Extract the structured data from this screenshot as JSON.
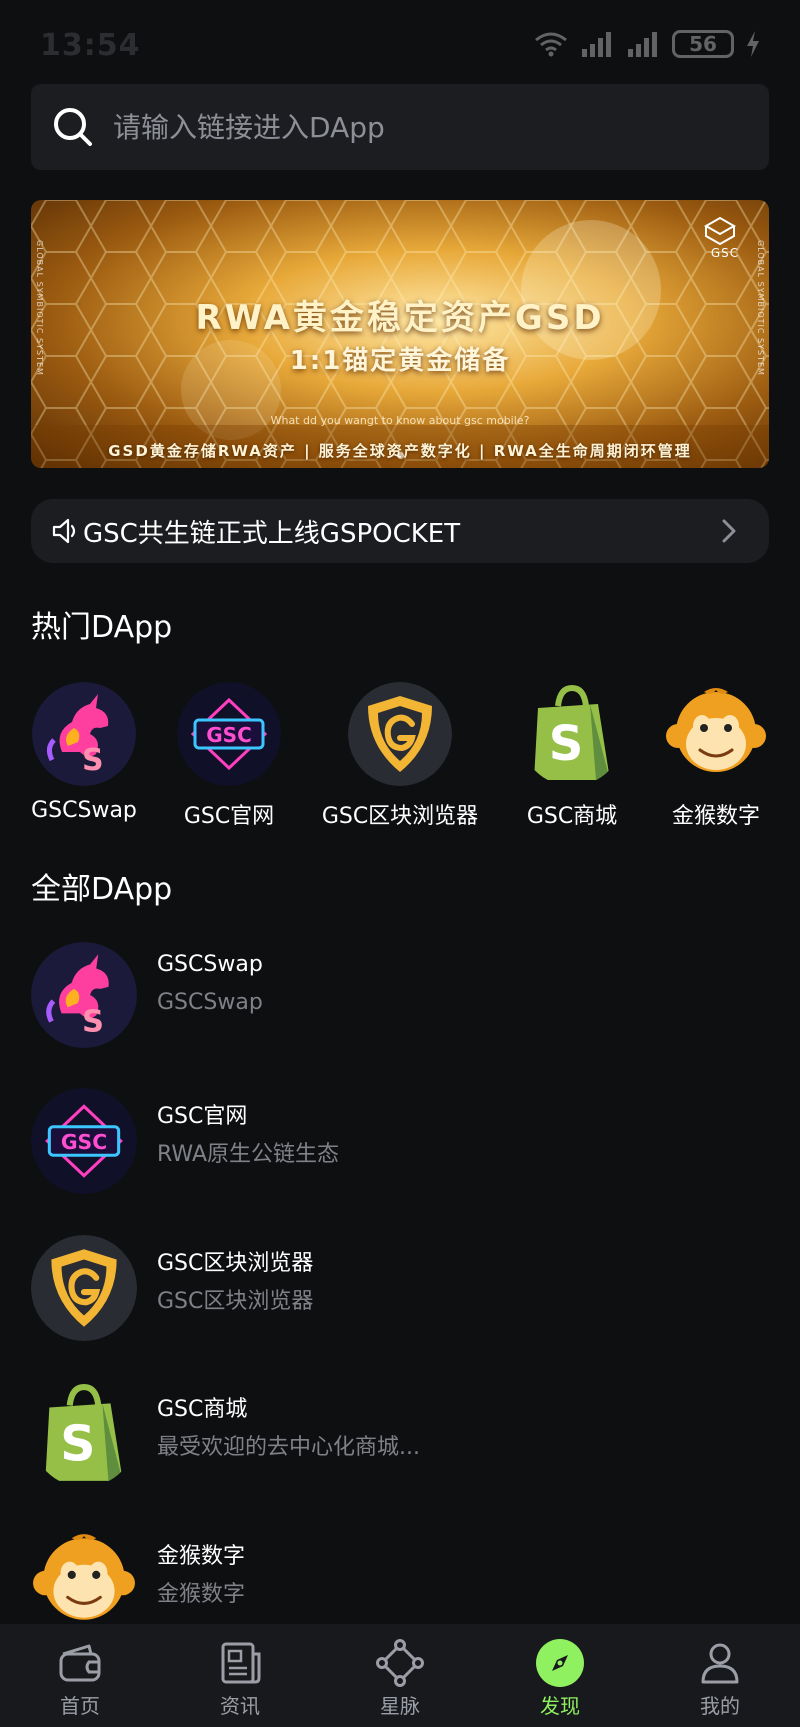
{
  "status_bar": {
    "time": "13:54",
    "battery": "56"
  },
  "search": {
    "placeholder": "请输入链接进入DApp"
  },
  "banner": {
    "title": "RWA黄金稳定资产GSD",
    "subtitle": "1:1锚定黄金储备",
    "caption": "What dd you wangt to know about gsc mobile?",
    "footer": "GSD黄金存储RWA资产 | 服务全球资产数字化 | RWA全生命周期闭环管理",
    "logo_text": "GSC",
    "side_text": "GLOBAL SYMBIOTIC SYSTEM"
  },
  "notice": {
    "text": "GSC共生链正式上线GSPOCKET"
  },
  "hot": {
    "title": "热门DApp",
    "items": [
      {
        "label": "GSCSwap",
        "icon": "unicorn-icon"
      },
      {
        "label": "GSC官网",
        "icon": "gsc-neon-icon"
      },
      {
        "label": "GSC区块浏览器",
        "icon": "g-shield-icon"
      },
      {
        "label": "GSC商城",
        "icon": "shopify-bag-icon"
      },
      {
        "label": "金猴数字",
        "icon": "monkey-icon"
      }
    ]
  },
  "all": {
    "title": "全部DApp",
    "items": [
      {
        "title": "GSCSwap",
        "subtitle": "GSCSwap",
        "icon": "unicorn-icon"
      },
      {
        "title": "GSC官网",
        "subtitle": "RWA原生公链生态",
        "icon": "gsc-neon-icon"
      },
      {
        "title": "GSC区块浏览器",
        "subtitle": "GSC区块浏览器",
        "icon": "g-shield-icon"
      },
      {
        "title": "GSC商城",
        "subtitle": "最受欢迎的去中心化商城...",
        "icon": "shopify-bag-icon"
      },
      {
        "title": "金猴数字",
        "subtitle": "金猴数字",
        "icon": "monkey-icon"
      }
    ]
  },
  "nav": {
    "items": [
      {
        "label": "首页",
        "icon": "wallet-icon"
      },
      {
        "label": "资讯",
        "icon": "news-icon"
      },
      {
        "label": "星脉",
        "icon": "network-icon"
      },
      {
        "label": "发现",
        "icon": "compass-icon",
        "active": true
      },
      {
        "label": "我的",
        "icon": "person-icon"
      }
    ]
  },
  "colors": {
    "accent": "#8ff060",
    "background": "#0e0f11",
    "card": "#1c1d21"
  }
}
